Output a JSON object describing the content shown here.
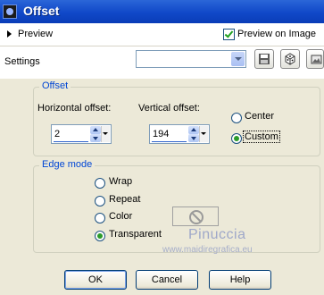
{
  "window": {
    "title": "Offset",
    "icon": "app-icon"
  },
  "preview": {
    "label": "Preview",
    "preview_on_image_label": "Preview on Image",
    "preview_on_image_checked": true
  },
  "settings": {
    "label": "Settings",
    "selected": "",
    "tools": [
      "save-preset-icon",
      "randomize-icon",
      "reset-icon"
    ]
  },
  "offset": {
    "group_title": "Offset",
    "horizontal_label": "Horizontal offset:",
    "horizontal_value": "2",
    "vertical_label": "Vertical offset:",
    "vertical_value": "194",
    "center_label": "Center",
    "custom_label": "Custom",
    "selected": "Custom"
  },
  "edge_mode": {
    "group_title": "Edge mode",
    "options": [
      "Wrap",
      "Repeat",
      "Color",
      "Transparent"
    ],
    "selected": "Transparent"
  },
  "watermark": {
    "name": "Pinuccia",
    "url": "www.maidiregrafica.eu"
  },
  "buttons": {
    "ok": "OK",
    "cancel": "Cancel",
    "help": "Help"
  },
  "colors": {
    "title_bar": "#1048c8",
    "group_title": "#0046d5",
    "panel_bg": "#ece9d8",
    "check_green": "#21a121"
  }
}
